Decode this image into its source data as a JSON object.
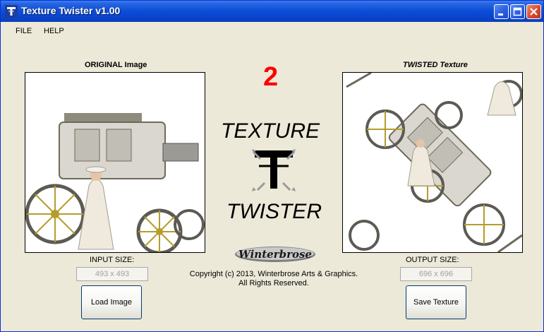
{
  "window": {
    "title": "Texture Twister v1.00"
  },
  "menu": {
    "items": [
      "FILE",
      "HELP"
    ]
  },
  "original": {
    "label": "ORIGINAL Image",
    "input_size_label": "INPUT SIZE:",
    "input_size_value": "493 x 493",
    "load_button": "Load Image"
  },
  "twisted": {
    "label": "TWISTED Texture",
    "output_size_label": "OUTPUT SIZE:",
    "output_size_value": "696 x 696",
    "save_button": "Save Texture"
  },
  "center": {
    "step_number": "2",
    "logo_top": "TEXTURE",
    "logo_bottom": "TWISTER",
    "brand": "Winterbrose",
    "copyright_line1": "Copyright (c) 2013, Winterbrose Arts & Graphics.",
    "copyright_line2": "All Rights Reserved."
  },
  "colors": {
    "titlebar": "#0b46cf",
    "background": "#ece9d8",
    "step_number": "#ff0000"
  },
  "icons": [
    "app-t-icon",
    "minimize-icon",
    "maximize-icon",
    "close-icon"
  ]
}
